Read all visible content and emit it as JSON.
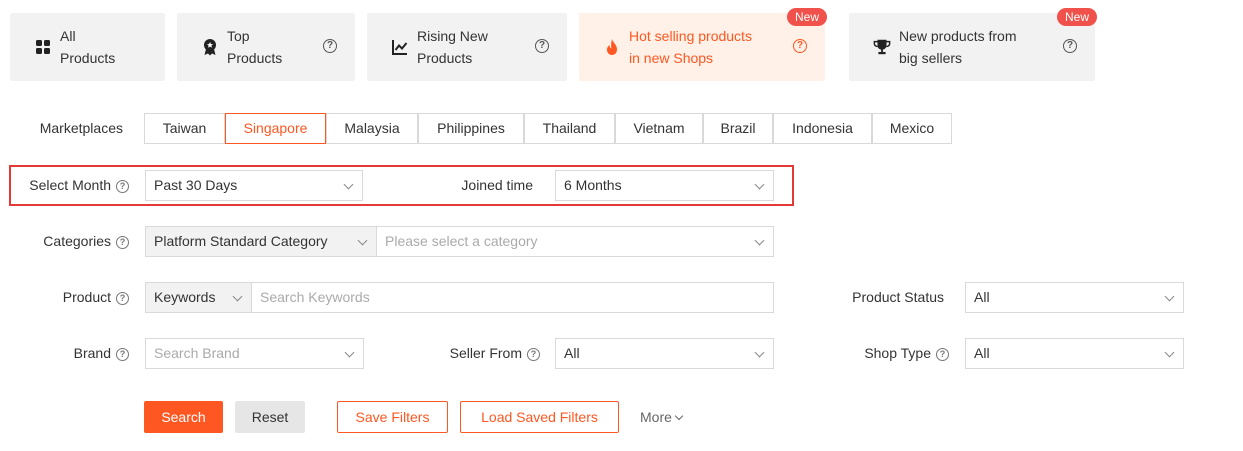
{
  "tabs": [
    {
      "label_line1": "All",
      "label_line2": "Products",
      "icon": "grid-icon",
      "help": false,
      "active": false,
      "badge": ""
    },
    {
      "label_line1": "Top",
      "label_line2": "Products",
      "icon": "award-medal-icon",
      "help": true,
      "active": false,
      "badge": ""
    },
    {
      "label_line1": "Rising New",
      "label_line2": "Products",
      "icon": "trending-line-icon",
      "help": true,
      "active": false,
      "badge": ""
    },
    {
      "label_line1": "Hot selling products",
      "label_line2": "in new Shops",
      "icon": "flame-icon",
      "help": true,
      "active": true,
      "badge": "New"
    },
    {
      "label_line1": "New products from",
      "label_line2": "big sellers",
      "icon": "trophy-icon",
      "help": true,
      "active": false,
      "badge": "New"
    }
  ],
  "help_glyph": "?",
  "filters": {
    "marketplaces": {
      "label": "Marketplaces",
      "options": [
        "Taiwan",
        "Singapore",
        "Malaysia",
        "Philippines",
        "Thailand",
        "Vietnam",
        "Brazil",
        "Indonesia",
        "Mexico"
      ],
      "selected": "Singapore"
    },
    "select_month": {
      "label": "Select Month",
      "value": "Past 30 Days"
    },
    "joined_time": {
      "label": "Joined time",
      "value": "6 Months"
    },
    "categories": {
      "label": "Categories",
      "type_value": "Platform Standard Category",
      "placeholder": "Please select a category"
    },
    "product": {
      "label": "Product",
      "type_value": "Keywords",
      "placeholder": "Search Keywords"
    },
    "product_status": {
      "label": "Product Status",
      "value": "All"
    },
    "brand": {
      "label": "Brand",
      "placeholder": "Search Brand"
    },
    "seller_from": {
      "label": "Seller From",
      "value": "All"
    },
    "shop_type": {
      "label": "Shop Type",
      "value": "All"
    }
  },
  "actions": {
    "search": "Search",
    "reset": "Reset",
    "save_filters": "Save Filters",
    "load_saved_filters": "Load Saved Filters",
    "more": "More"
  },
  "colors": {
    "accent": "#ff5722",
    "highlight": "#e53935",
    "badge": "#f0514a"
  }
}
